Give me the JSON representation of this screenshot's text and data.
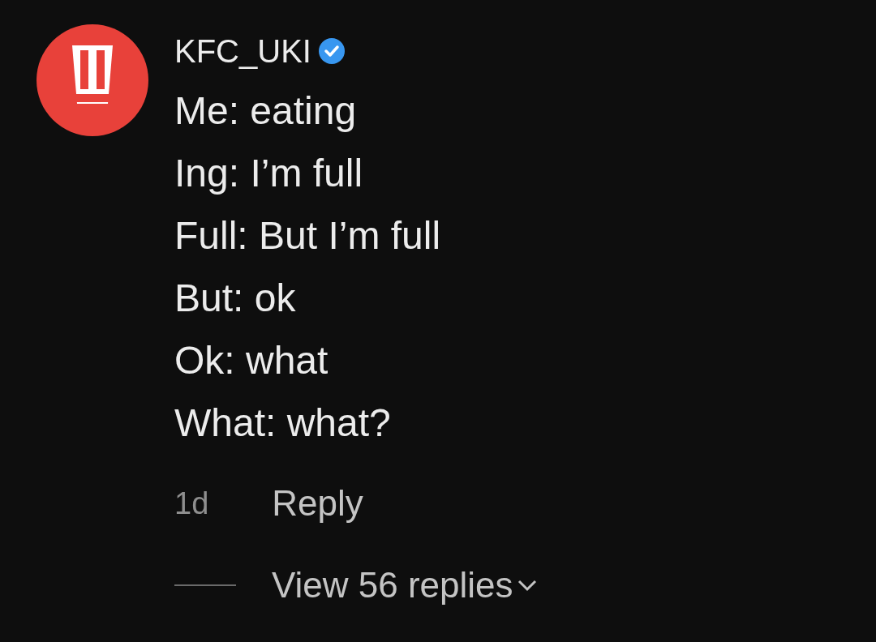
{
  "comment": {
    "username": "KFC_UKI",
    "verified": true,
    "lines": [
      "Me: eating",
      "Ing: I’m full",
      "Full: But I’m full",
      "But: ok",
      "Ok: what",
      "What: what?"
    ],
    "time": "1d",
    "reply": "Reply",
    "view_replies": "View 56 replies"
  }
}
